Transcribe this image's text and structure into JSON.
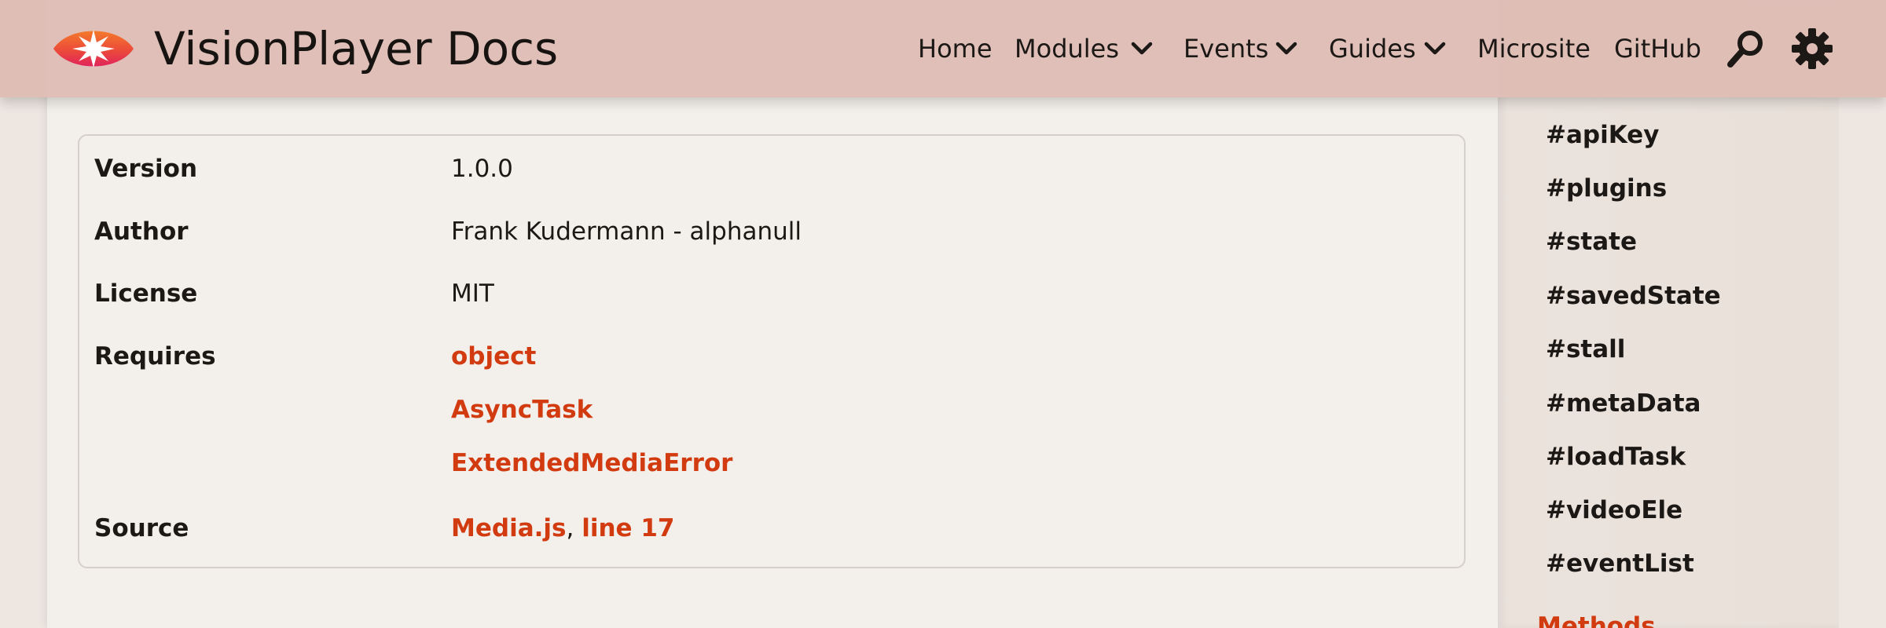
{
  "header": {
    "brand": "VisionPlayer Docs",
    "nav": [
      {
        "label": "Home"
      },
      {
        "label": "Modules"
      },
      {
        "label": "Events"
      },
      {
        "label": "Guides"
      },
      {
        "label": "Microsite"
      },
      {
        "label": "GitHub"
      }
    ],
    "search_icon": "search-icon",
    "settings_icon": "gear-icon"
  },
  "properties": {
    "version_label": "Version",
    "version_value": "1.0.0",
    "author_label": "Author",
    "author_value": "Frank Kudermann - alphanull",
    "license_label": "License",
    "license_value": "MIT",
    "requires_label": "Requires",
    "requires": [
      "object",
      "AsyncTask",
      "ExtendedMediaError"
    ],
    "source_label": "Source",
    "source_file": "Media.js",
    "source_separator": ",",
    "source_line": "line 17"
  },
  "sidebar": {
    "items": [
      {
        "label": "#apiKey"
      },
      {
        "label": "#plugins"
      },
      {
        "label": "#state"
      },
      {
        "label": "#savedState"
      },
      {
        "label": "#stall"
      },
      {
        "label": "#metaData"
      },
      {
        "label": "#loadTask"
      },
      {
        "label": "#videoEle"
      },
      {
        "label": "#eventList"
      }
    ],
    "section": "Methods"
  },
  "colors": {
    "link": "#d23a10",
    "header_bg": "#debcb4",
    "content_bg": "#f3efeb",
    "sidebar_bg": "#ebe2dc",
    "text": "#1c1816"
  }
}
